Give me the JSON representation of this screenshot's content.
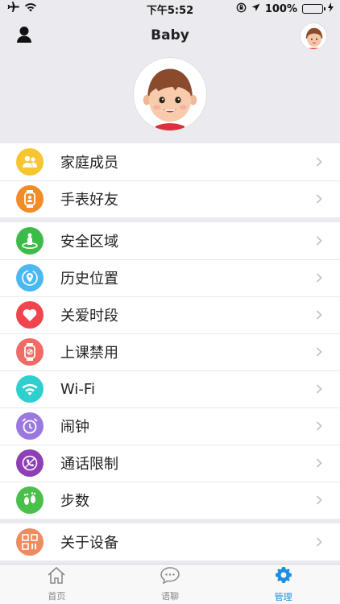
{
  "status": {
    "time": "下午5:52",
    "battery": "100%",
    "battery_level": 1.0
  },
  "header": {
    "title": "Baby"
  },
  "sections": [
    {
      "items": [
        {
          "label": "家庭成员",
          "icon": "family-members-icon",
          "color": "#f7c531"
        },
        {
          "label": "手表好友",
          "icon": "watch-friends-icon",
          "color": "#f28c28"
        }
      ]
    },
    {
      "items": [
        {
          "label": "安全区域",
          "icon": "safe-zone-icon",
          "color": "#3dbb4a"
        },
        {
          "label": "历史位置",
          "icon": "location-history-icon",
          "color": "#4cb8f2"
        },
        {
          "label": "关爱时段",
          "icon": "care-period-icon",
          "color": "#f0454f"
        },
        {
          "label": "上课禁用",
          "icon": "class-disable-icon",
          "color": "#f06a66"
        },
        {
          "label": "Wi-Fi",
          "icon": "wifi-icon",
          "color": "#2fcfcf"
        },
        {
          "label": "闹钟",
          "icon": "alarm-icon",
          "color": "#9b78e0"
        },
        {
          "label": "通话限制",
          "icon": "call-limit-icon",
          "color": "#8e3fb5"
        },
        {
          "label": "步数",
          "icon": "steps-icon",
          "color": "#4bbf4c"
        }
      ]
    },
    {
      "items": [
        {
          "label": "关于设备",
          "icon": "about-device-icon",
          "color": "#f08a5f"
        }
      ]
    }
  ],
  "tabs": [
    {
      "label": "首页",
      "icon": "home-icon"
    },
    {
      "label": "语聊",
      "icon": "chat-icon"
    },
    {
      "label": "管理",
      "icon": "gear-icon",
      "active": true
    }
  ]
}
